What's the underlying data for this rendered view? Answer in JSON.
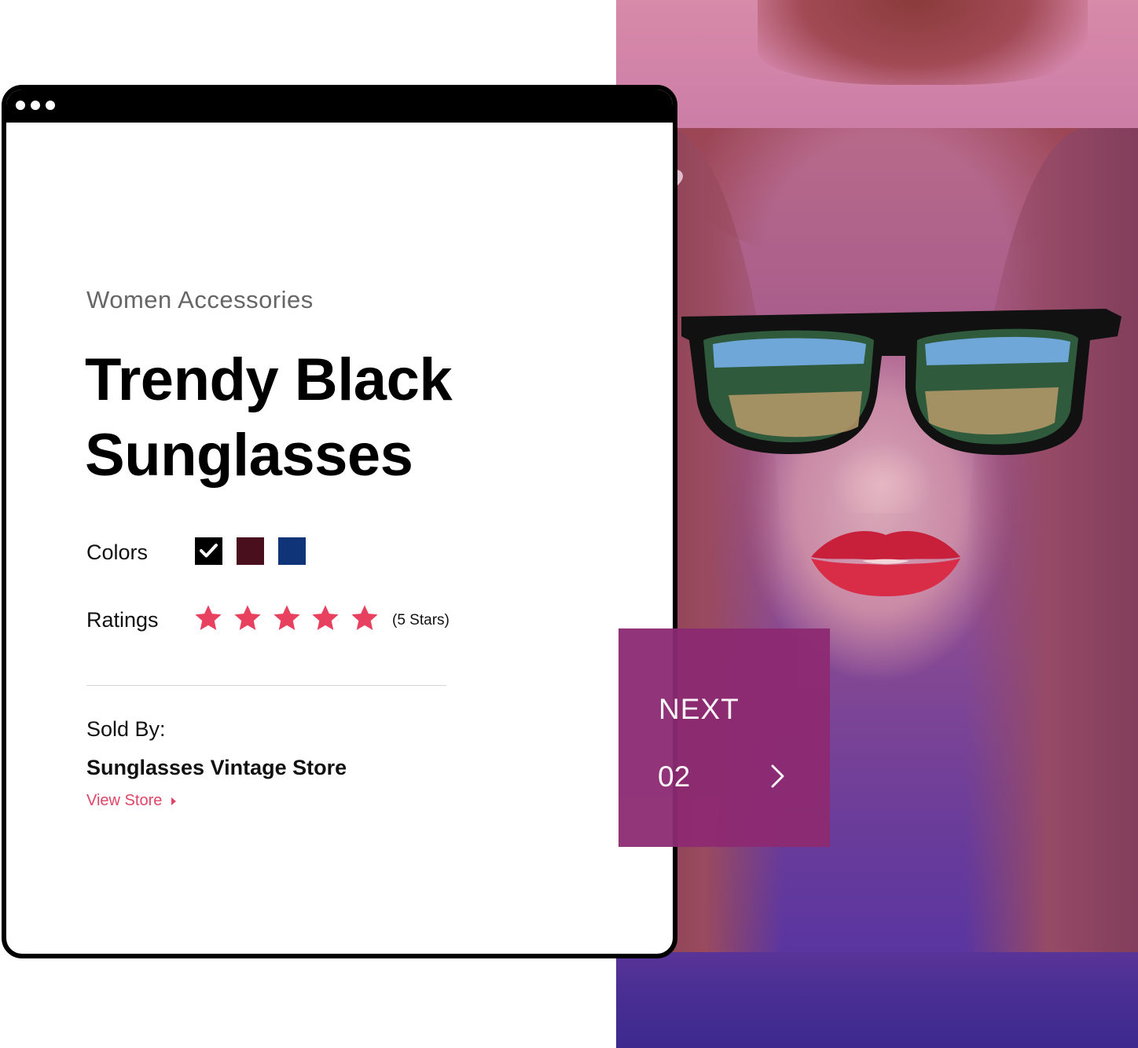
{
  "product": {
    "category": "Women Accessories",
    "title_line1": "Trendy Black",
    "title_line2": "Sunglasses",
    "colors_label": "Colors",
    "colors": [
      {
        "hex": "#000000",
        "selected": true
      },
      {
        "hex": "#4a0f1c",
        "selected": false
      },
      {
        "hex": "#0f3578",
        "selected": false
      }
    ],
    "ratings_label": "Ratings",
    "rating_value": 5,
    "rating_text": "(5 Stars)",
    "star_color": "#e8405f"
  },
  "seller": {
    "sold_by_label": "Sold By:",
    "store_name": "Sunglasses Vintage Store",
    "view_store_label": "View Store"
  },
  "carousel": {
    "next_label": "NEXT",
    "next_number": "02",
    "card_color": "#8d2a72"
  },
  "icons": {
    "favorite": "heart-icon",
    "next": "chevron-right-icon",
    "selected": "check-icon",
    "link": "caret-right-icon"
  },
  "colors": {
    "accent": "#e04466",
    "muted_text": "#666666"
  }
}
